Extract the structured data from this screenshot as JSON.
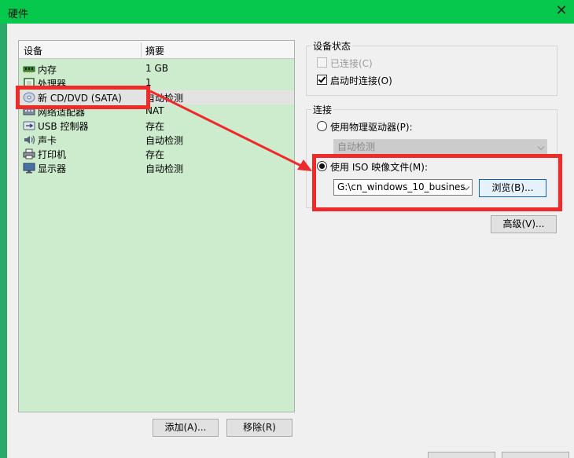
{
  "window": {
    "title": "硬件",
    "close_glyph": "✕"
  },
  "device_list": {
    "col_device": "设备",
    "col_summary": "摘要",
    "items": [
      {
        "name": "内存",
        "summary": "1 GB",
        "icon": "memory-icon"
      },
      {
        "name": "处理器",
        "summary": "1",
        "icon": "processor-icon"
      },
      {
        "name": "新 CD/DVD (SATA)",
        "summary": "自动检测",
        "icon": "cd-dvd-icon"
      },
      {
        "name": "网络适配器",
        "summary": "NAT",
        "icon": "network-adapter-icon"
      },
      {
        "name": "USB 控制器",
        "summary": "存在",
        "icon": "usb-icon"
      },
      {
        "name": "声卡",
        "summary": "自动检测",
        "icon": "sound-card-icon"
      },
      {
        "name": "打印机",
        "summary": "存在",
        "icon": "printer-icon"
      },
      {
        "name": "显示器",
        "summary": "自动检测",
        "icon": "display-icon"
      }
    ],
    "selected_index": 2,
    "add_label": "添加(A)...",
    "remove_label": "移除(R)"
  },
  "device_status": {
    "title": "设备状态",
    "connected_label": "已连接(C)",
    "connected": false,
    "connect_at_power_on_label": "启动时连接(O)",
    "connect_at_power_on": true
  },
  "connection": {
    "title": "连接",
    "physical_drive_label": "使用物理驱动器(P):",
    "physical_drive_value": "自动检测",
    "iso_label": "使用 ISO 映像文件(M):",
    "iso_path": "G:\\cn_windows_10_busines",
    "browse_label": "浏览(B)...",
    "selected": "iso"
  },
  "advanced_label": "高级(V)...",
  "colors": {
    "title_bar": "#06c84c",
    "annotation_red": "#ee2a2a",
    "list_background": "#cdeccd"
  }
}
